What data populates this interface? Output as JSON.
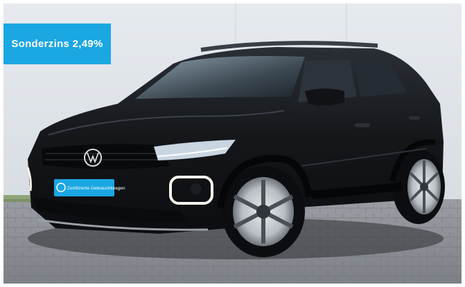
{
  "promo_badge": {
    "label": "Sonderzins 2,49%",
    "background": "#1aa7e2",
    "text_color": "#ffffff"
  },
  "plate": {
    "label": "Zertifizierte Gebrauchtwagen",
    "background": "#1aa7e2"
  },
  "car": {
    "color": "#15171c",
    "background_wall": "#dfe4ea",
    "ground": "#8c9096"
  }
}
